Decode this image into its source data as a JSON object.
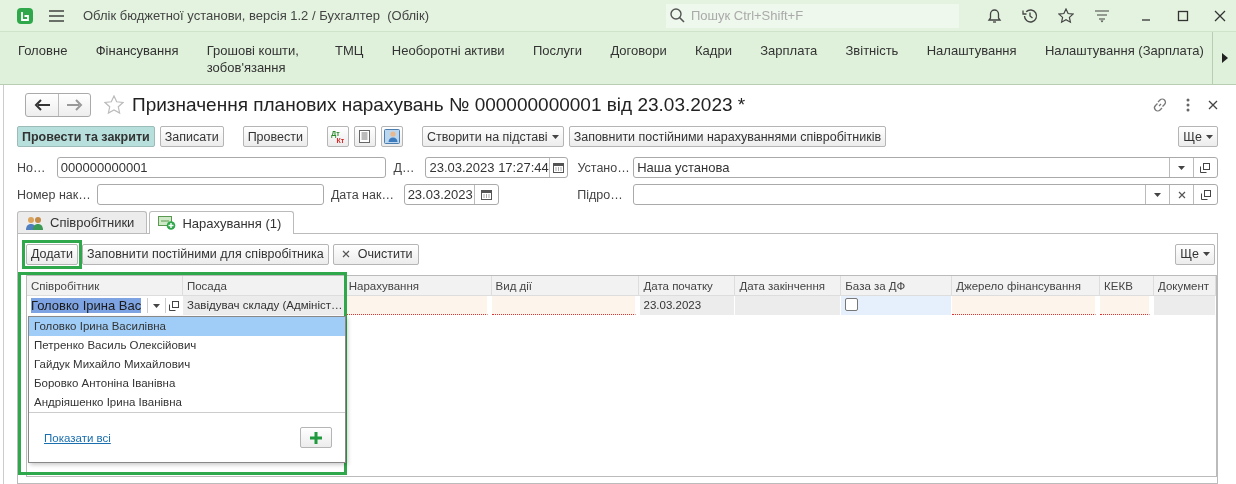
{
  "app_bar": {
    "title": "Облік бюджетної установи, версія 1.2 / Бухгалтер  (Облік)",
    "search": {
      "placeholder": "Пошук Ctrl+Shift+F"
    }
  },
  "sections": [
    "Головне",
    "Фінансування",
    "Грошові кошти, зобов'язання",
    "ТМЦ",
    "Необоротні активи",
    "Послуги",
    "Договори",
    "Кадри",
    "Зарплата",
    "Звітність",
    "Налаштування",
    "Налаштування (Зарплата)"
  ],
  "form": {
    "title": "Призначення планових нарахувань № 000000000001 від 23.03.2023 *",
    "commands": [
      {
        "kind": "primary",
        "label": "Провести та закрити"
      },
      {
        "kind": "button",
        "label": "Записати"
      },
      {
        "kind": "button",
        "label": "Провести"
      },
      {
        "kind": "dtkt",
        "top": "Дт",
        "bottom": "Кт"
      },
      {
        "kind": "report"
      },
      {
        "kind": "card"
      },
      {
        "kind": "menu",
        "label": "Створити на підставі"
      },
      {
        "kind": "button",
        "label": "Заповнити постійними нарахуваннями співробітників"
      }
    ],
    "more": "Ще",
    "field_rows": [
      [
        {
          "kind": "text",
          "label": "Но…",
          "value": "000000000001"
        },
        {
          "kind": "date",
          "label": "Д…",
          "value": "23.03.2023 17:27:44"
        },
        {
          "kind": "ref",
          "label": "Устано…",
          "value": "Наша установа"
        }
      ],
      [
        {
          "kind": "text",
          "label": "Номер нак…"
        },
        {
          "kind": "date",
          "label": "Дата нак…",
          "value": "23.03.2023"
        },
        {
          "kind": "ref_clear",
          "label": "Підро…"
        }
      ]
    ],
    "tabs": [
      {
        "label": "Співробітники",
        "selected": false
      },
      {
        "label": "Нарахування (1)",
        "selected": true
      }
    ],
    "tab_toolbar": {
      "buttons": [
        {
          "kind": "button",
          "label": "Додати",
          "highlighted": true
        },
        {
          "kind": "button",
          "label": "Заповнити постійними для співробітника",
          "highlighted": false
        },
        {
          "kind": "clear",
          "label": "Очистити",
          "highlighted": false
        }
      ],
      "more": "Ще"
    },
    "table": {
      "columns": [
        "Співробітник",
        "Посада",
        "Нарахування",
        "Вид дії",
        "Дата початку",
        "Дата закінчення",
        "База за ДФ",
        "Джерело фінансування",
        "КЕКВ",
        "Документ"
      ],
      "rows": [
        {
          "cells": [
            {
              "kind": "editing",
              "value": "Головко Ірина Вас"
            },
            {
              "kind": "text",
              "value": "Завідувач складу (Адмініст…"
            },
            {
              "kind": "required"
            },
            {
              "kind": "required"
            },
            {
              "kind": "readonly",
              "value": "23.03.2023"
            },
            {
              "kind": "readonly"
            },
            {
              "kind": "checkbox",
              "checked": false
            },
            {
              "kind": "required"
            },
            {
              "kind": "required"
            },
            {
              "kind": "readonly"
            }
          ]
        }
      ]
    },
    "dropdown": {
      "items": [
        {
          "label": "Головко Ірина Василівна",
          "selected": true
        },
        {
          "label": "Петренко Василь Олексійович",
          "selected": false
        },
        {
          "label": "Гайдук Михайло Михайлович",
          "selected": false
        },
        {
          "label": "Боровко Антоніна Іванівна",
          "selected": false
        },
        {
          "label": "Андріяшенко Ірина Іванівна",
          "selected": false
        }
      ],
      "show_all": "Показати всі"
    }
  }
}
